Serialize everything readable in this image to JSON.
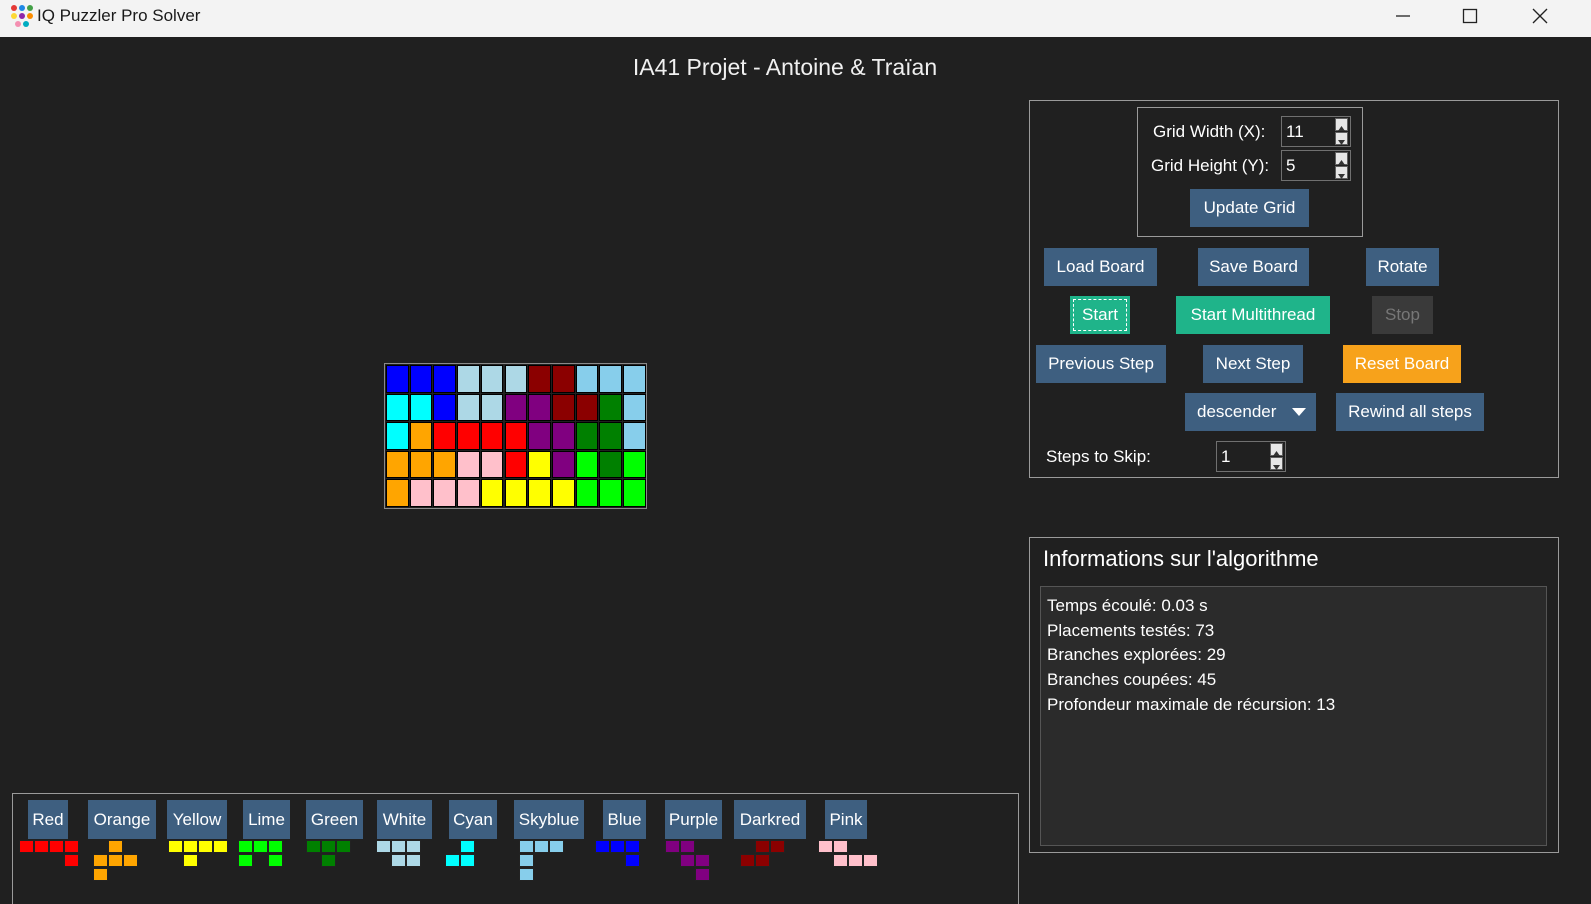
{
  "window": {
    "title": "IQ Puzzler Pro Solver",
    "controls": [
      "minimize",
      "maximize",
      "close"
    ]
  },
  "header": {
    "title": "IA41 Projet - Antoine & Traïan"
  },
  "colors": {
    "Red": "#ff0000",
    "Orange": "#ffa500",
    "Yellow": "#ffff00",
    "Lime": "#00ff00",
    "Green": "#008000",
    "White": "#add8e6",
    "Cyan": "#00ffff",
    "Skyblue": "#87ceeb",
    "Blue": "#0000ff",
    "Purple": "#800080",
    "Darkred": "#8b0000",
    "Pink": "#ffc0cb",
    "button": "#3e5f80",
    "start": "#1fb48a",
    "reset": "#f7a21b",
    "stop": "#3a3a3a"
  },
  "board": {
    "width": 11,
    "height": 5,
    "rows": [
      [
        "Blue",
        "Blue",
        "Blue",
        "White",
        "White",
        "White",
        "Darkred",
        "Darkred",
        "Skyblue",
        "Skyblue",
        "Skyblue"
      ],
      [
        "Cyan",
        "Cyan",
        "Blue",
        "White",
        "White",
        "Purple",
        "Purple",
        "Darkred",
        "Darkred",
        "Green",
        "Skyblue"
      ],
      [
        "Cyan",
        "Orange",
        "Red",
        "Red",
        "Red",
        "Red",
        "Purple",
        "Purple",
        "Green",
        "Green",
        "Skyblue"
      ],
      [
        "Orange",
        "Orange",
        "Orange",
        "Pink",
        "Pink",
        "Red",
        "Yellow",
        "Purple",
        "Lime",
        "Green",
        "Lime"
      ],
      [
        "Orange",
        "Pink",
        "Pink",
        "Pink",
        "Yellow",
        "Yellow",
        "Yellow",
        "Yellow",
        "Lime",
        "Lime",
        "Lime"
      ]
    ]
  },
  "grid_settings": {
    "width_label": "Grid Width (X):",
    "width_value": "11",
    "height_label": "Grid Height (Y):",
    "height_value": "5",
    "update_label": "Update Grid"
  },
  "controls": {
    "load": "Load Board",
    "save": "Save Board",
    "rotate": "Rotate",
    "start": "Start",
    "start_multi": "Start Multithread",
    "stop": "Stop",
    "previous": "Previous Step",
    "next": "Next Step",
    "reset": "Reset Board",
    "order_value": "descender",
    "rewind": "Rewind all steps",
    "skip_label": "Steps to Skip:",
    "skip_value": "1"
  },
  "info": {
    "title": "Informations sur l'algorithme",
    "lines": [
      "Temps écoulé: 0.03 s",
      "Placements testés: 73",
      "Branches explorées: 29",
      "Branches coupées: 45",
      "Profondeur maximale de récursion: 13"
    ]
  },
  "pieces": [
    {
      "name": "Red",
      "color": "#ff0000",
      "cells": [
        [
          0,
          0
        ],
        [
          1,
          0
        ],
        [
          2,
          0
        ],
        [
          3,
          0
        ],
        [
          3,
          1
        ]
      ]
    },
    {
      "name": "Orange",
      "color": "#ffa500",
      "cells": [
        [
          1,
          0
        ],
        [
          0,
          1
        ],
        [
          1,
          1
        ],
        [
          2,
          1
        ],
        [
          0,
          2
        ]
      ]
    },
    {
      "name": "Yellow",
      "color": "#ffff00",
      "cells": [
        [
          0,
          0
        ],
        [
          1,
          0
        ],
        [
          2,
          0
        ],
        [
          3,
          0
        ],
        [
          1,
          1
        ]
      ]
    },
    {
      "name": "Lime",
      "color": "#00ff00",
      "cells": [
        [
          0,
          0
        ],
        [
          1,
          0
        ],
        [
          2,
          0
        ],
        [
          0,
          1
        ],
        [
          2,
          1
        ]
      ]
    },
    {
      "name": "Green",
      "color": "#008000",
      "cells": [
        [
          0,
          0
        ],
        [
          1,
          0
        ],
        [
          2,
          0
        ],
        [
          1,
          1
        ]
      ]
    },
    {
      "name": "White",
      "color": "#add8e6",
      "cells": [
        [
          0,
          0
        ],
        [
          1,
          0
        ],
        [
          2,
          0
        ],
        [
          1,
          1
        ],
        [
          2,
          1
        ]
      ]
    },
    {
      "name": "Cyan",
      "color": "#00ffff",
      "cells": [
        [
          1,
          0
        ],
        [
          0,
          1
        ],
        [
          1,
          1
        ]
      ]
    },
    {
      "name": "Skyblue",
      "color": "#87ceeb",
      "cells": [
        [
          0,
          0
        ],
        [
          1,
          0
        ],
        [
          2,
          0
        ],
        [
          0,
          1
        ],
        [
          0,
          2
        ]
      ]
    },
    {
      "name": "Blue",
      "color": "#0000ff",
      "cells": [
        [
          0,
          0
        ],
        [
          1,
          0
        ],
        [
          2,
          0
        ],
        [
          2,
          1
        ]
      ]
    },
    {
      "name": "Purple",
      "color": "#800080",
      "cells": [
        [
          0,
          0
        ],
        [
          1,
          0
        ],
        [
          1,
          1
        ],
        [
          2,
          1
        ],
        [
          2,
          2
        ]
      ]
    },
    {
      "name": "Darkred",
      "color": "#8b0000",
      "cells": [
        [
          1,
          0
        ],
        [
          2,
          0
        ],
        [
          0,
          1
        ],
        [
          1,
          1
        ]
      ]
    },
    {
      "name": "Pink",
      "color": "#ffc0cb",
      "cells": [
        [
          0,
          0
        ],
        [
          1,
          0
        ],
        [
          1,
          1
        ],
        [
          2,
          1
        ],
        [
          3,
          1
        ]
      ]
    }
  ]
}
